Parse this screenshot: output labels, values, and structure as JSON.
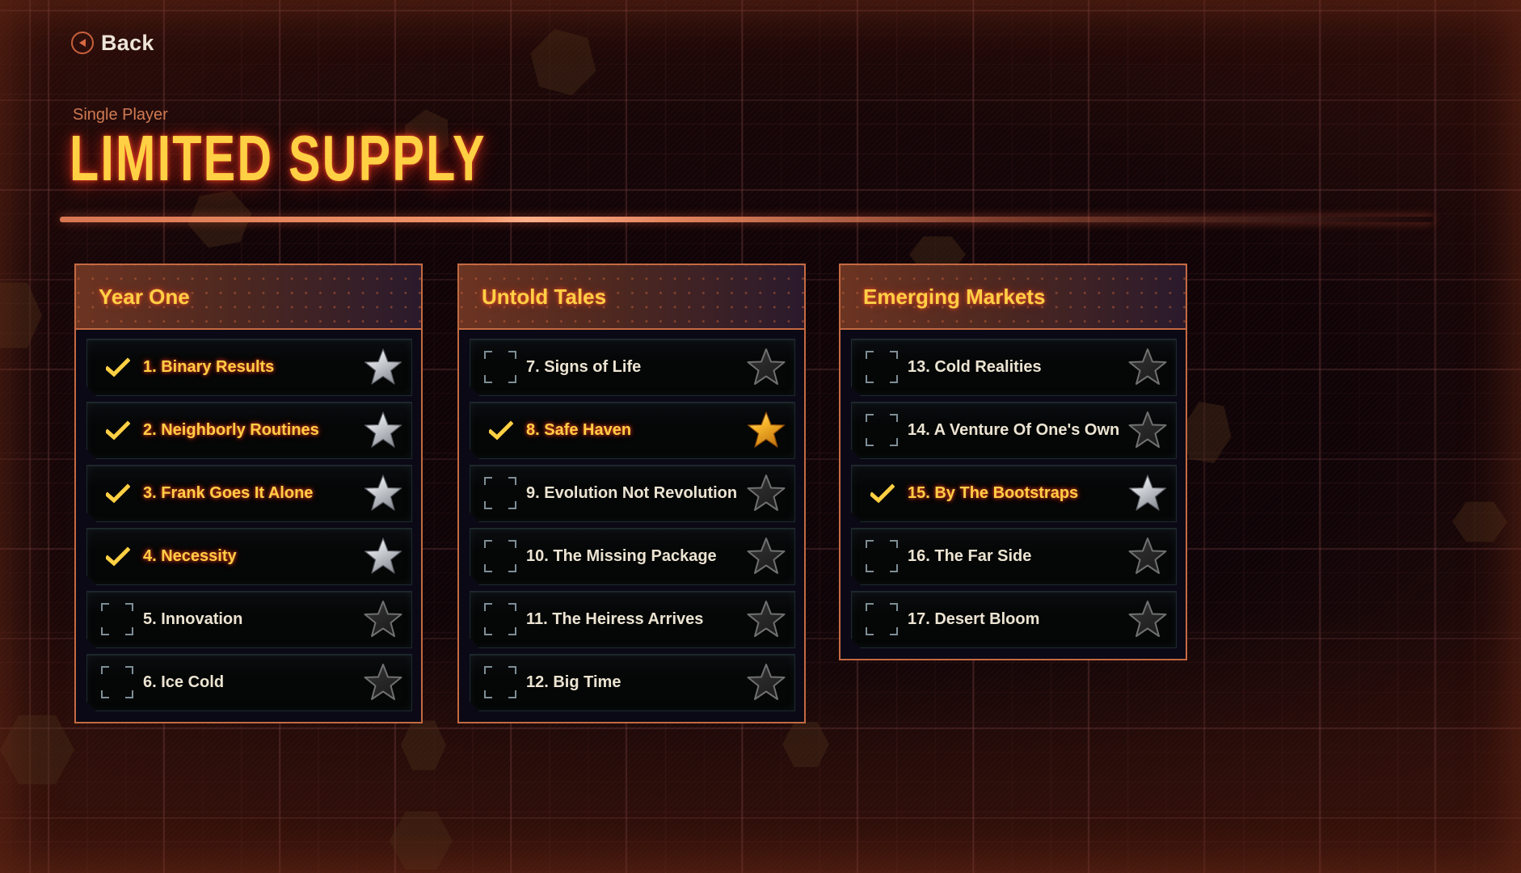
{
  "nav": {
    "back_label": "Back"
  },
  "header": {
    "subtitle": "Single Player",
    "title": "LIMITED SUPPLY"
  },
  "colors": {
    "accent_gold": "#ffd043",
    "accent_orange": "#c46a42",
    "star_gold": "#f5b22a",
    "star_silver": "#c8ccd0",
    "star_empty": "#2e2e2e"
  },
  "chapters": [
    {
      "title": "Year One",
      "missions": [
        {
          "label": "1.  Binary Results",
          "completed": true,
          "star": "silver"
        },
        {
          "label": "2.  Neighborly Routines",
          "completed": true,
          "star": "silver"
        },
        {
          "label": "3.  Frank Goes It Alone",
          "completed": true,
          "star": "silver"
        },
        {
          "label": "4.  Necessity",
          "completed": true,
          "star": "silver"
        },
        {
          "label": "5.  Innovation",
          "completed": false,
          "star": "empty"
        },
        {
          "label": "6.  Ice Cold",
          "completed": false,
          "star": "empty"
        }
      ]
    },
    {
      "title": "Untold Tales",
      "missions": [
        {
          "label": "7.  Signs of Life",
          "completed": false,
          "star": "empty"
        },
        {
          "label": "8.  Safe Haven",
          "completed": true,
          "star": "gold"
        },
        {
          "label": "9.  Evolution Not Revolution",
          "completed": false,
          "star": "empty"
        },
        {
          "label": "10. The Missing Package",
          "completed": false,
          "star": "empty"
        },
        {
          "label": "11. The Heiress Arrives",
          "completed": false,
          "star": "empty"
        },
        {
          "label": "12. Big Time",
          "completed": false,
          "star": "empty"
        }
      ]
    },
    {
      "title": "Emerging Markets",
      "missions": [
        {
          "label": "13. Cold Realities",
          "completed": false,
          "star": "empty"
        },
        {
          "label": "14. A Venture Of One's Own",
          "completed": false,
          "star": "empty"
        },
        {
          "label": "15. By The Bootstraps",
          "completed": true,
          "star": "silver"
        },
        {
          "label": "16. The Far Side",
          "completed": false,
          "star": "empty"
        },
        {
          "label": "17. Desert Bloom",
          "completed": false,
          "star": "empty"
        }
      ]
    }
  ]
}
